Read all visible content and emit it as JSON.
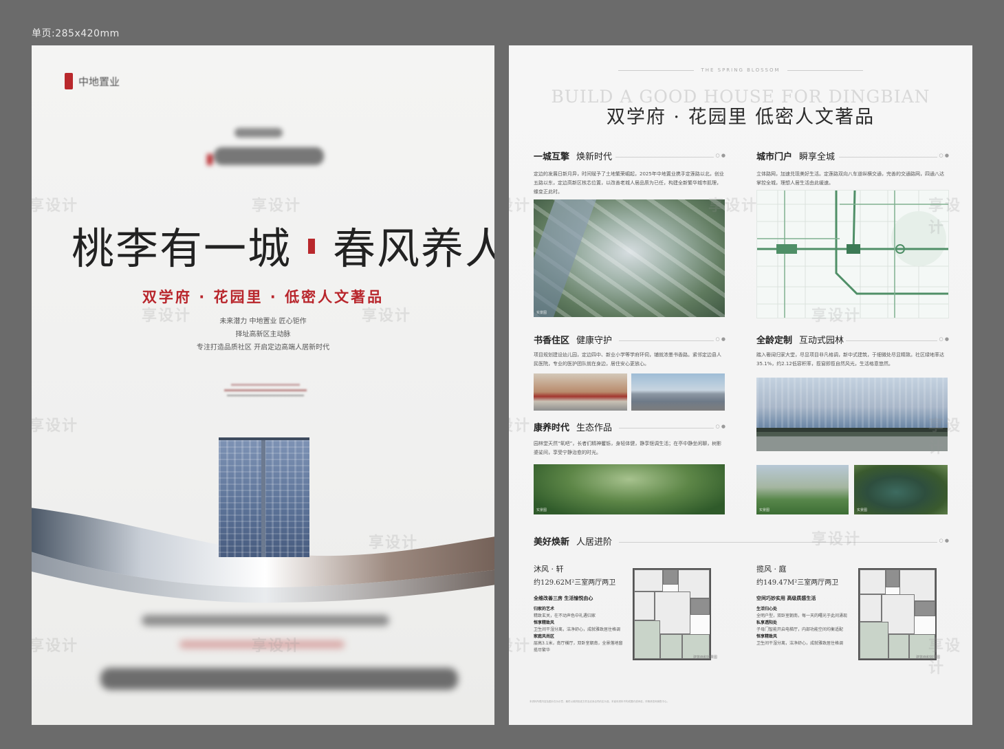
{
  "size_label": "单页:285x420mm",
  "watermark": "享设计",
  "left": {
    "headline_part1": "桃李有一城",
    "headline_part2": "春风养人生",
    "tagline": "双学府 · 花园里 · 低密人文著品",
    "desc": [
      "未来潜力  中地置业  匠心钜作",
      "择址高新区主动脉",
      "专注打造品质社区  开启定边高端人居新时代"
    ]
  },
  "right": {
    "spring_label": "THE SPRING BLOSSOM",
    "build_en": "BUILD A GOOD HOUSE FOR DINGBIAN",
    "title": "双学府 · 花园里   低密人文著品",
    "s1": {
      "title_bold": "一城互擎",
      "title_rest": "焕新时代",
      "text": "定边的发展日新月异，时间赋予了土地繁荣崛起，2025年中地置业携手定莲路以北，创业五路以东，定边高新区核芯位置，以改善老城人居品质为已任，构建全新繁华城市肌理，蝶变正此时。"
    },
    "s2": {
      "title_bold": "城市门户",
      "title_rest": "瞬享全城",
      "text": "立体路网，加速兑现美好生活。定莲路双向八车道纵横交通，完善的交通路网，四通八达掌控全城，理想人居生活由此缓速。"
    },
    "s3": {
      "title_bold": "书香住区",
      "title_rest": "健康守护",
      "text": "项目规划建设幼儿园，定边四中、新业小学等学府环伺，铺就浓墨书香路。紧邻定边县人民医院，专业的医护团队就在身边，居住安心更放心。"
    },
    "s4": {
      "title_bold": "全龄定制",
      "title_rest": "互动式园林",
      "text": "踏入奢阔归家大堂，尽显项目非凡格调，新中式建筑，于细微处尽显精致。社区绿地率达35.1%，约2.12低容积率，揽窗即揽自然风光，生活格意悠然。"
    },
    "s5": {
      "title_bold": "康养时代",
      "title_rest": "生态作品",
      "text": "园林堂天然“氧吧”，长者们精神矍铄，身轻体健，静享惬调生活；在亭中静坐闲聊，树影婆娑间，享受宁静治愈的时光。"
    },
    "s6": {
      "title_bold": "美好焕新",
      "title_rest": "人居进阶"
    },
    "plan1": {
      "name": "沐风 · 轩",
      "area": "约129.62M²三室两厅两卫",
      "sub": "全维改善三房 生活愉悦由心",
      "f1_title": "归家的艺术",
      "f1": "精致玄关，在不动声色中礼遇归家",
      "f2_title": "恒享精致风",
      "f2": "卫生间干湿分离，洁净舒心，成就雅致居住格调",
      "f3_title": "家庭风尚区",
      "f3": "层高3.1米，南厅横厅，双卧室朝南，全景落地窗揽尽繁华"
    },
    "plan2": {
      "name": "揽风 · 庭",
      "area": "约149.47M²三室两厅两卫",
      "sub": "空间巧妙实用 高级质感生活",
      "f1_title": "生活归心处",
      "f1": "全明户型，双卧室朝南，每一天的曙光于此间涌现",
      "f2_title": "私享透阳处",
      "f2": "子母门智能开启电梯厅，内部功能空间均衡适配",
      "f3_title": "恒享精致风",
      "f3": "卫生间干湿分离，洁净舒心，成就雅致居住格调"
    },
    "plan_caption": "建筑面积效果图",
    "img_tag": "实景图",
    "footer_note": "本资料所载内容及图片仅为示意，最终以政府批准文件及买卖合同约定为准。本宣传资料不构成要约或承诺，详情请咨询销售中心。"
  }
}
